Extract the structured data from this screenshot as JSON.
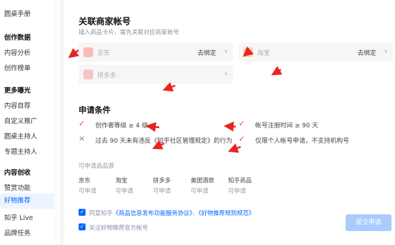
{
  "sidebar": {
    "items": [
      {
        "label": "圆桌手册",
        "type": "item"
      },
      {
        "label": "创作数据",
        "type": "head"
      },
      {
        "label": "内容分析",
        "type": "item"
      },
      {
        "label": "创作榜单",
        "type": "item"
      },
      {
        "label": "更多曝光",
        "type": "head"
      },
      {
        "label": "内容自荐",
        "type": "item"
      },
      {
        "label": "自定义推广",
        "type": "item"
      },
      {
        "label": "圆桌主持人",
        "type": "item"
      },
      {
        "label": "专题主持人",
        "type": "item"
      },
      {
        "label": "内容创收",
        "type": "head"
      },
      {
        "label": "赞赏功能",
        "type": "item"
      },
      {
        "label": "好物推荐",
        "type": "active"
      },
      {
        "label": "知乎 Live",
        "type": "item"
      },
      {
        "label": "品牌任务",
        "type": "item"
      }
    ]
  },
  "main": {
    "title": "关联商家帐号",
    "subtitle": "插入商品卡片，需先关联对应商家帐号",
    "merchants": [
      {
        "name": "京东",
        "action": "去绑定",
        "icon": "jd-logo-icon",
        "color": "#fbb9b9"
      },
      {
        "name": "淘宝",
        "action": "去绑定",
        "icon": "taobao-logo-icon",
        "color": "#fcd2b0"
      },
      {
        "name": "拼多多",
        "action": "",
        "icon": "pinduoduo-logo-icon",
        "color": "#fbc3c3"
      }
    ],
    "conditions_title": "申请条件",
    "conditions": [
      {
        "text": "创作者等级 ≥ 4 级",
        "status": "ok"
      },
      {
        "text": "帐号注册时间 ≥ 90 天",
        "status": "ok"
      },
      {
        "text": "过去 90 天未有违反《知乎社区管理规定》的行为",
        "status": "no"
      },
      {
        "text": "仅限个人帐号申请，不支持机构号",
        "status": "ok"
      }
    ],
    "sources_label": "可申请选品源",
    "sources": [
      {
        "name": "京东",
        "status": "可申请"
      },
      {
        "name": "淘宝",
        "status": "可申请"
      },
      {
        "name": "拼多多",
        "status": "可申请"
      },
      {
        "name": "美团酒旅",
        "status": "可申请"
      },
      {
        "name": "知乎商品",
        "status": "可申请"
      }
    ],
    "agreement": {
      "prefix": "同意知乎",
      "link1": "《商品信息发布功能服务协议》",
      "sep": "、",
      "link2": "《好物推荐规则规范》"
    },
    "follow_label": "关注好物推荐官方帐号",
    "submit_label": "提交申请"
  },
  "colors": {
    "accent": "#0066ff",
    "annotation_arrow": "#e8251f",
    "submit_disabled": "#a9cbff",
    "active_bg": "#eef4ff"
  }
}
